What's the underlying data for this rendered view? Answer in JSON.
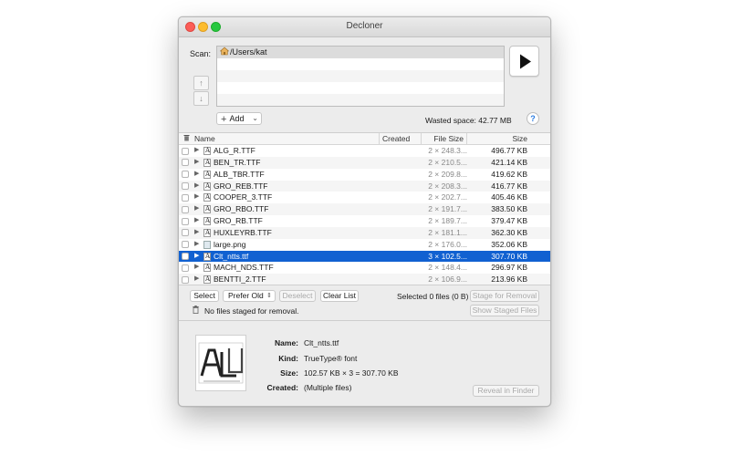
{
  "window": {
    "title": "Decloner"
  },
  "scan": {
    "label": "Scan:",
    "paths": [
      "/Users/kat",
      "",
      "",
      "",
      ""
    ],
    "up_label": "↑",
    "down_label": "↓"
  },
  "add_button": {
    "label": "Add"
  },
  "wasted_space": "Wasted space: 42.77 MB",
  "help_label": "?",
  "table": {
    "columns": {
      "name": "Name",
      "created": "Created",
      "file_size": "File Size",
      "size": "Size"
    },
    "rows": [
      {
        "name": "ALG_R.TTF",
        "file_size": "2 × 248.3...",
        "size": "496.77 KB",
        "icon": "font",
        "selected": false
      },
      {
        "name": "BEN_TR.TTF",
        "file_size": "2 × 210.5...",
        "size": "421.14 KB",
        "icon": "font",
        "selected": false
      },
      {
        "name": "ALB_TBR.TTF",
        "file_size": "2 × 209.8...",
        "size": "419.62 KB",
        "icon": "font",
        "selected": false
      },
      {
        "name": "GRO_REB.TTF",
        "file_size": "2 × 208.3...",
        "size": "416.77 KB",
        "icon": "font",
        "selected": false
      },
      {
        "name": "COOPER_3.TTF",
        "file_size": "2 × 202.7...",
        "size": "405.46 KB",
        "icon": "font",
        "selected": false
      },
      {
        "name": "GRO_RBO.TTF",
        "file_size": "2 × 191.7...",
        "size": "383.50 KB",
        "icon": "font",
        "selected": false
      },
      {
        "name": "GRO_RB.TTF",
        "file_size": "2 × 189.7...",
        "size": "379.47 KB",
        "icon": "font",
        "selected": false
      },
      {
        "name": "HUXLEYRB.TTF",
        "file_size": "2 × 181.1...",
        "size": "362.30 KB",
        "icon": "font",
        "selected": false
      },
      {
        "name": "large.png",
        "file_size": "2 × 176.0...",
        "size": "352.06 KB",
        "icon": "image",
        "selected": false
      },
      {
        "name": "Clt_ntts.ttf",
        "file_size": "3 × 102.5...",
        "size": "307.70 KB",
        "icon": "font",
        "selected": true
      },
      {
        "name": "MACH_NDS.TTF",
        "file_size": "2 × 148.4...",
        "size": "296.97 KB",
        "icon": "font",
        "selected": false
      },
      {
        "name": "BENTTI_2.TTF",
        "file_size": "2 × 106.9...",
        "size": "213.96 KB",
        "icon": "font",
        "selected": false
      }
    ]
  },
  "actions": {
    "select": "Select",
    "prefer": "Prefer Old",
    "deselect": "Deselect",
    "clear_list": "Clear List",
    "selected_info": "Selected 0 files (0 B)",
    "stage_for_removal": "Stage for Removal",
    "staged_status": "No files staged for removal.",
    "show_staged": "Show Staged Files"
  },
  "details": {
    "name_label": "Name:",
    "name_value": "Clt_ntts.ttf",
    "kind_label": "Kind:",
    "kind_value": "TrueType® font",
    "size_label": "Size:",
    "size_value": "102.57 KB × 3 = 307.70 KB",
    "created_label": "Created:",
    "created_value": "(Multiple files)",
    "reveal_button": "Reveal in Finder"
  },
  "colors": {
    "selection": "#1161d1",
    "close": "#fc5d57",
    "minimize": "#fdbc2e",
    "maximize": "#27c840",
    "help": "#2b7be0"
  }
}
